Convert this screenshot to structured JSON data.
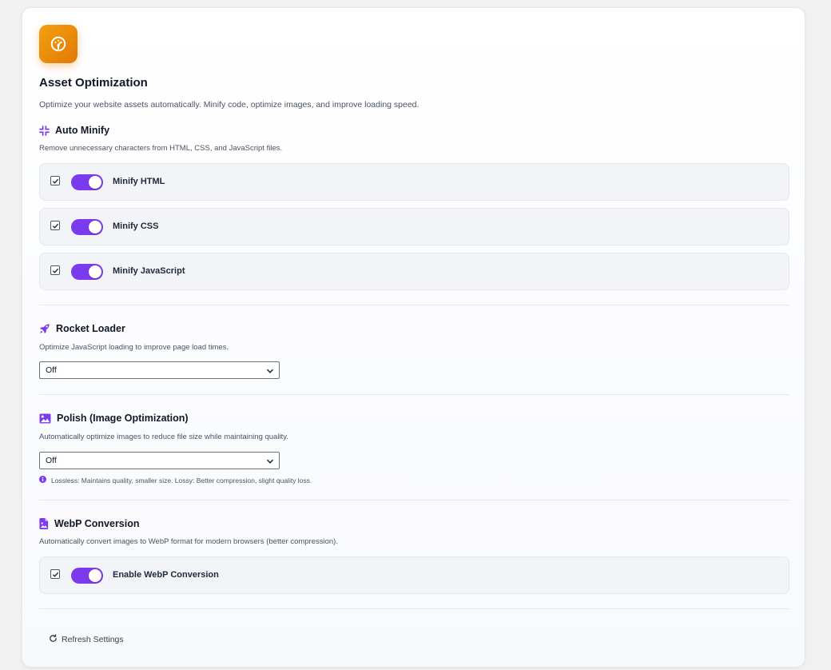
{
  "header": {
    "title": "Asset Optimization",
    "description": "Optimize your website assets automatically. Minify code, optimize images, and improve loading speed.",
    "icon": "speedometer-icon",
    "icon_color": "#f08c0a"
  },
  "accent": "#7c3aed",
  "auto_minify": {
    "title": "Auto Minify",
    "description": "Remove unnecessary characters from HTML, CSS, and JavaScript files.",
    "icon": "compress-icon",
    "items": [
      {
        "label": "Minify HTML",
        "checked": true,
        "enabled": true
      },
      {
        "label": "Minify CSS",
        "checked": true,
        "enabled": true
      },
      {
        "label": "Minify JavaScript",
        "checked": true,
        "enabled": true
      }
    ]
  },
  "rocket_loader": {
    "title": "Rocket Loader",
    "description": "Optimize JavaScript loading to improve page load times.",
    "icon": "rocket-icon",
    "selected": "Off"
  },
  "polish": {
    "title": "Polish (Image Optimization)",
    "description": "Automatically optimize images to reduce file size while maintaining quality.",
    "icon": "image-icon",
    "selected": "Off",
    "hint": "Lossless: Maintains quality, smaller size. Lossy: Better compression, slight quality loss."
  },
  "webp": {
    "title": "WebP Conversion",
    "description": "Automatically convert images to WebP format for modern browsers (better compression).",
    "icon": "file-image-icon",
    "item": {
      "label": "Enable WebP Conversion",
      "checked": true,
      "enabled": true
    }
  },
  "footer": {
    "refresh_label": "Refresh Settings"
  }
}
